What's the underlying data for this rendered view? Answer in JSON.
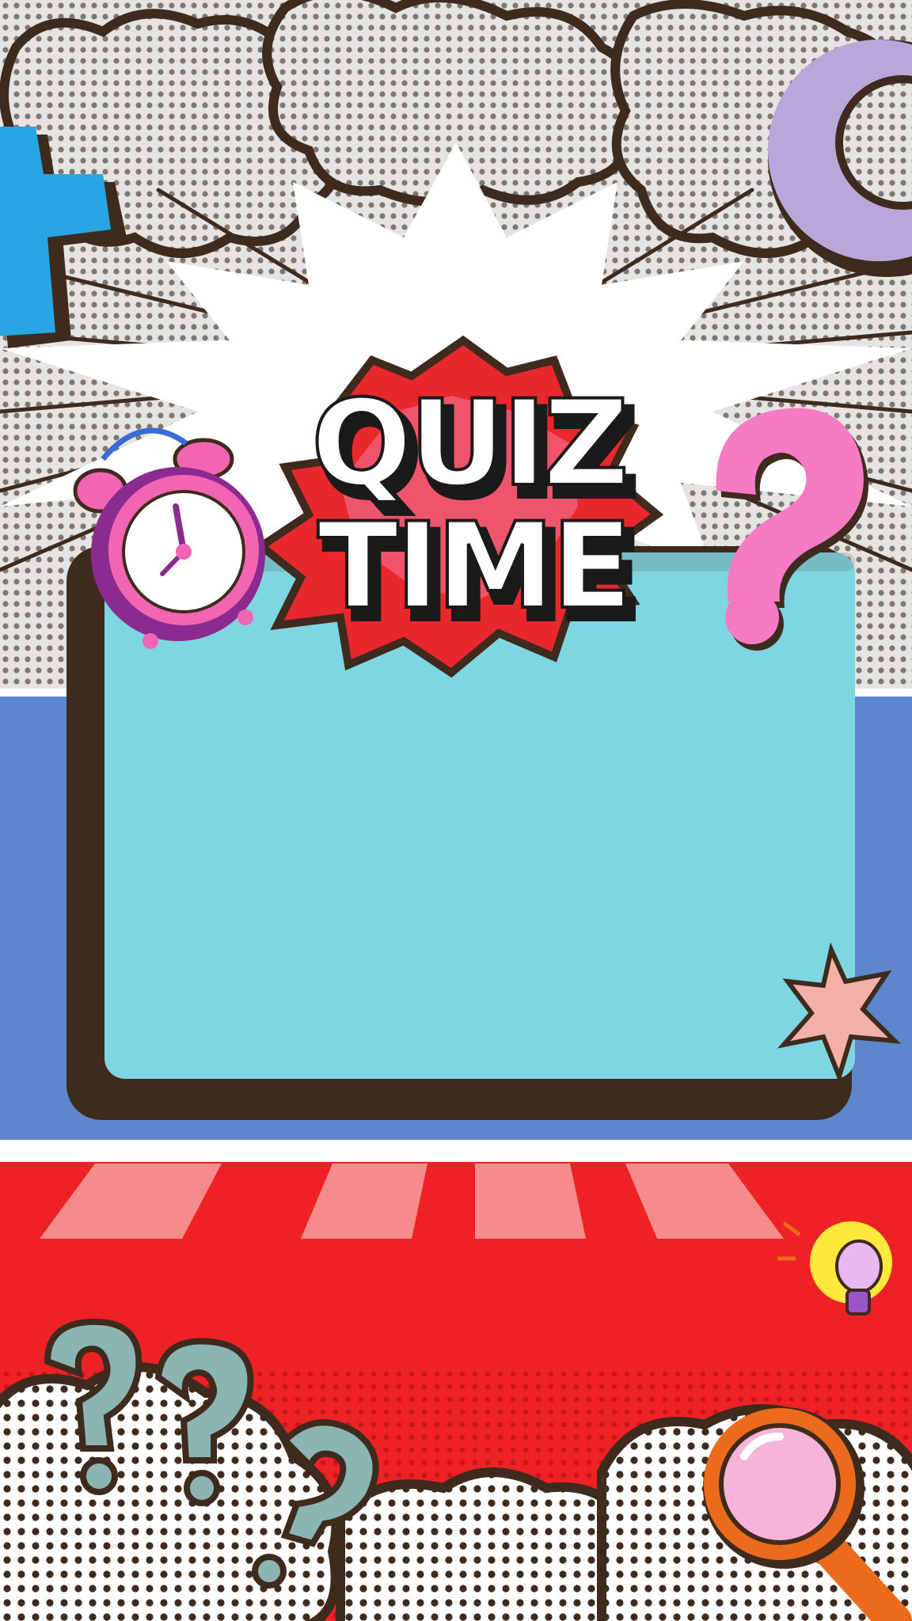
{
  "poster": {
    "title_line1": "QUIZ",
    "title_line2": "TIME"
  },
  "colors": {
    "top_halftone_bg": "#c9c6c3",
    "outline_brown": "#3e2b1e",
    "burst_white": "#ffffff",
    "card_fill": "#7fd6e3",
    "side_band_blue": "#5d86cc",
    "bottom_red": "#ee2224",
    "stripe_light_red": "#f58b8b",
    "title_burst_red": "#e8282c",
    "title_burst_pink": "#f5799e",
    "plus_blue": "#27a6e3",
    "ring_lavender": "#b7a8d9",
    "question_pink": "#f77ac5",
    "question_teal": "#8ab5b2",
    "clock_purple": "#8b2a8f",
    "clock_pink": "#f265b3",
    "star_peach": "#f4b0a6",
    "bulb_yellow": "#fde83c",
    "magnifier_orange": "#ec6a1b",
    "magnifier_lens": "#f6b5d8"
  },
  "icons": [
    "plus-icon",
    "ring-icon",
    "alarm-clock-icon",
    "question-mark-icon",
    "star-icon",
    "light-bulb-icon",
    "magnifying-glass-icon"
  ]
}
